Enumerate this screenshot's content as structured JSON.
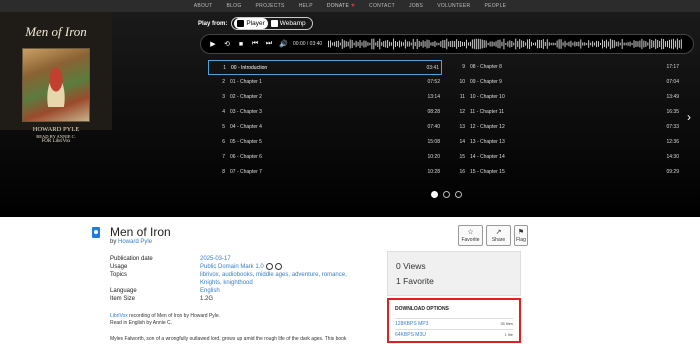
{
  "nav": [
    "ABOUT",
    "BLOG",
    "PROJECTS",
    "HELP",
    "DONATE",
    "CONTACT",
    "JOBS",
    "VOLUNTEER",
    "PEOPLE"
  ],
  "cover": {
    "title": "Men of Iron",
    "author": "HOWARD PYLE",
    "reader": "READ BY ANNIE C.",
    "for_line": "FOR LibriVox"
  },
  "play_from": {
    "label": "Play from:",
    "player": "Player",
    "webamp": "Webamp"
  },
  "player": {
    "time": "00:00 / 03:40"
  },
  "tracks_left": [
    {
      "num": "1",
      "title": "00 - Introduction",
      "dur": "03:41"
    },
    {
      "num": "2",
      "title": "01 - Chapter 1",
      "dur": "07:52"
    },
    {
      "num": "3",
      "title": "02 - Chapter 2",
      "dur": "13:14"
    },
    {
      "num": "4",
      "title": "03 - Chapter 3",
      "dur": "08:28"
    },
    {
      "num": "5",
      "title": "04 - Chapter 4",
      "dur": "07:40"
    },
    {
      "num": "6",
      "title": "05 - Chapter 5",
      "dur": "15:08"
    },
    {
      "num": "7",
      "title": "06 - Chapter 6",
      "dur": "10:20"
    },
    {
      "num": "8",
      "title": "07 - Chapter 7",
      "dur": "10:28"
    }
  ],
  "tracks_right": [
    {
      "num": "9",
      "title": "08 - Chapter 8",
      "dur": "17:17"
    },
    {
      "num": "10",
      "title": "09 - Chapter 9",
      "dur": "07:04"
    },
    {
      "num": "11",
      "title": "10 - Chapter 10",
      "dur": "13:49"
    },
    {
      "num": "12",
      "title": "11 - Chapter 11",
      "dur": "16:35"
    },
    {
      "num": "13",
      "title": "12 - Chapter 12",
      "dur": "07:33"
    },
    {
      "num": "14",
      "title": "13 - Chapter 13",
      "dur": "12:36"
    },
    {
      "num": "15",
      "title": "14 - Chapter 14",
      "dur": "14:30"
    },
    {
      "num": "16",
      "title": "15 - Chapter 15",
      "dur": "09:29"
    }
  ],
  "item": {
    "title": "Men of Iron",
    "by": "by",
    "author": "Howard Pyle",
    "meta": {
      "pub_label": "Publication date",
      "pub": "2025-03-17",
      "usage_label": "Usage",
      "usage": "Public Domain Mark 1.0",
      "topics_label": "Topics",
      "topics1": "librivox, audiobooks, middle ages, adventure, romance,",
      "topics2": "Knights, knighthood",
      "lang_label": "Language",
      "lang": "English",
      "size_label": "Item Size",
      "size": "1.2G"
    },
    "desc_link": "LibriVox",
    "desc_a": " recording of Men of Iron by Howard Pyle.",
    "desc_b": "Read in English by Annie C.",
    "desc_c": "Myles Falworth, son of a wrongfully outlawed lord, grows up amid the rough life of the dark ages. This book"
  },
  "actions": {
    "favorite": "Favorite",
    "share": "Share",
    "flag": "Flag"
  },
  "stats": {
    "views": "0 Views",
    "favorites": "1 Favorite"
  },
  "download": {
    "header": "DOWNLOAD OPTIONS",
    "options": [
      {
        "name": "128KBPS MP3",
        "count": "35 files"
      },
      {
        "name": "64KBPS M3U",
        "count": "1 file"
      }
    ]
  }
}
